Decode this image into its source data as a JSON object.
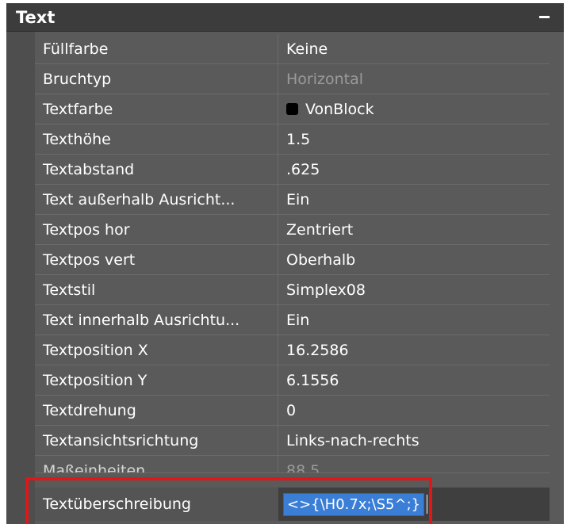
{
  "panel": {
    "title": "Text",
    "collapse_label": "–"
  },
  "properties": [
    {
      "label": "Füllfarbe",
      "value": "Keine",
      "disabled": false
    },
    {
      "label": "Bruchtyp",
      "value": "Horizontal",
      "disabled": true
    },
    {
      "label": "Textfarbe",
      "value": "VonBlock",
      "swatch_color": "#000000",
      "disabled": false
    },
    {
      "label": "Texthöhe",
      "value": "1.5",
      "disabled": false
    },
    {
      "label": "Textabstand",
      "value": ".625",
      "disabled": false
    },
    {
      "label": "Text außerhalb Ausricht...",
      "value": "Ein",
      "disabled": false
    },
    {
      "label": "Textpos hor",
      "value": "Zentriert",
      "disabled": false
    },
    {
      "label": "Textpos vert",
      "value": "Oberhalb",
      "disabled": false
    },
    {
      "label": "Textstil",
      "value": "Simplex08",
      "disabled": false
    },
    {
      "label": "Text innerhalb Ausrichtu...",
      "value": "Ein",
      "disabled": false
    },
    {
      "label": "Textposition X",
      "value": "16.2586",
      "disabled": false
    },
    {
      "label": "Textposition Y",
      "value": "6.1556",
      "disabled": false
    },
    {
      "label": "Textdrehung",
      "value": "0",
      "disabled": false
    },
    {
      "label": "Textansichtsrichtung",
      "value": "Links-nach-rechts",
      "disabled": false
    },
    {
      "label": "Maßeinheiten",
      "value": "88.5",
      "disabled": true
    }
  ],
  "override": {
    "label": "Textüberschreibung",
    "value": "<>{\\H0.7x;\\S5^;}"
  },
  "colors": {
    "panel_bg": "#5a5a5a",
    "header_bg": "#3c3c3c",
    "selection_bg": "#3a7ed6",
    "highlight_border": "#e11616"
  }
}
